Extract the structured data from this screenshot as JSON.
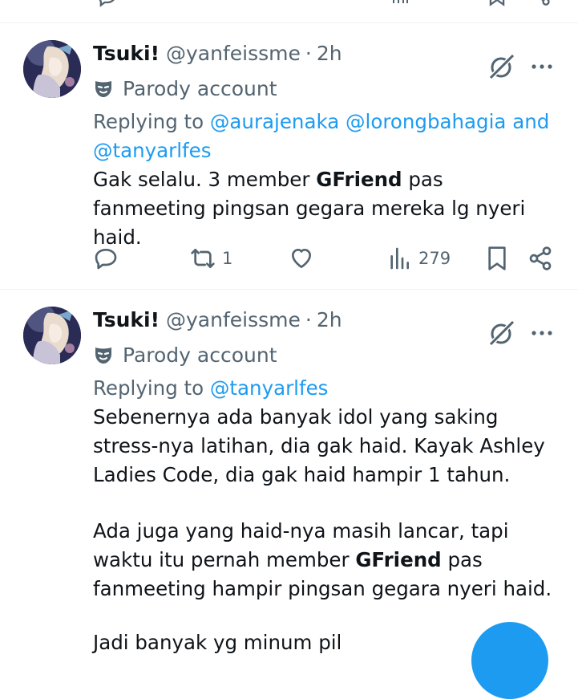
{
  "tweets": [
    {
      "name": "Tsuki!",
      "handle": "@yanfeissme",
      "separator": "·",
      "time": "2h",
      "parody_label": "Parody account",
      "replying_prefix": "Replying to",
      "mentions": [
        "@aurajenaka",
        "@lorongbahagia"
      ],
      "mentions_join": "and",
      "mention_last": "@tanyarlfes",
      "body": {
        "p1_before": "Gak selalu. 3 member ",
        "p1_bold": "GFriend",
        "p1_after": " pas fanmeeting pingsan gegara mereka lg nyeri haid."
      },
      "stats": {
        "retweets": "1",
        "views": "279"
      }
    },
    {
      "name": "Tsuki!",
      "handle": "@yanfeissme",
      "separator": "·",
      "time": "2h",
      "parody_label": "Parody account",
      "replying_prefix": "Replying to",
      "mention_last": "@tanyarlfes",
      "body": {
        "p1": "Sebenernya ada banyak idol yang saking stress-nya latihan, dia gak haid. Kayak Ashley Ladies Code, dia gak haid hampir 1 tahun.",
        "p2_before": "Ada juga yang haid-nya masih lancar, tapi waktu itu pernah member ",
        "p2_bold": "GFriend",
        "p2_after": " pas fanmeeting hampir pingsan gegara nyeri haid.",
        "p3_partial": "Jadi banyak yg minum pil"
      }
    }
  ],
  "colors": {
    "accent": "#1d9bf0",
    "text": "#0f1419",
    "secondary": "#536471",
    "divider": "#eff3f4"
  },
  "icons": [
    "reply-icon",
    "retweet-icon",
    "like-icon",
    "views-icon",
    "bookmark-icon",
    "share-icon",
    "grok-icon",
    "more-icon",
    "parody-mask-icon"
  ]
}
